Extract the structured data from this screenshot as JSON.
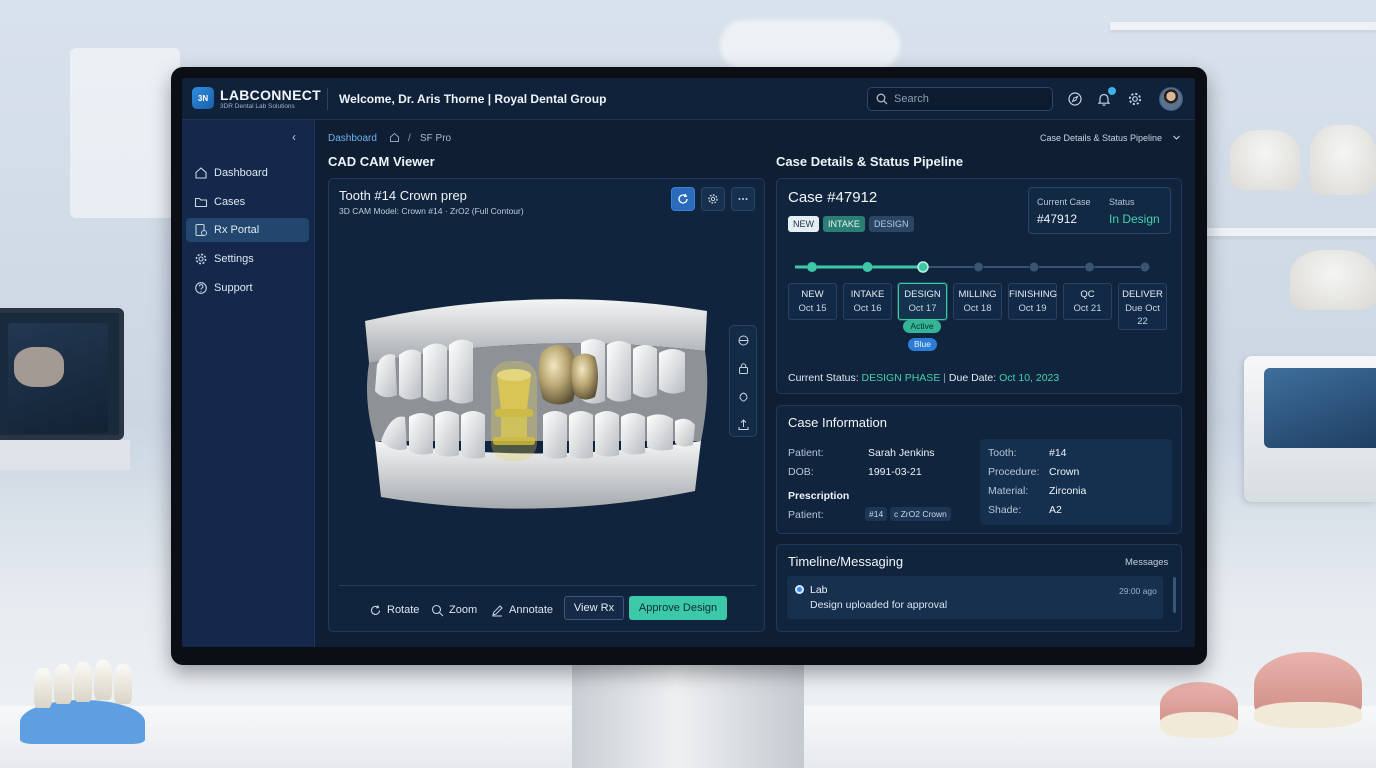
{
  "app": {
    "logo_mark": "3N",
    "name": "LABCONNECT",
    "tagline": "3DR Dental Lab Solutions",
    "welcome": "Welcome, Dr. Aris Thorne | Royal Dental Group"
  },
  "search": {
    "placeholder": "Search"
  },
  "icons": {
    "help": "compass-icon",
    "notifications": "bell-icon",
    "settings": "gear-icon"
  },
  "sidebar": {
    "collapse_glyph": "‹",
    "items": [
      {
        "label": "Dashboard",
        "icon": "home-icon",
        "active": false
      },
      {
        "label": "Cases",
        "icon": "folder-icon",
        "active": false
      },
      {
        "label": "Rx Portal",
        "icon": "rx-icon",
        "active": true
      },
      {
        "label": "Settings",
        "icon": "gear-icon",
        "active": false
      },
      {
        "label": "Support",
        "icon": "help-icon",
        "active": false
      }
    ]
  },
  "breadcrumb": {
    "link": "Dashboard",
    "separator": "/",
    "current": "SF Pro",
    "right_label": "Case Details & Status Pipeline"
  },
  "viewer": {
    "section_title": "CAD CAM Viewer",
    "title": "Tooth #14 Crown prep",
    "subtitle": "3D CAM Model: Crown #14 · ZrO2 (Full Contour)",
    "tools": [
      {
        "label": "Rotate",
        "icon": "rotate-icon"
      },
      {
        "label": "Zoom",
        "icon": "zoom-icon"
      },
      {
        "label": "Annotate",
        "icon": "pencil-icon"
      }
    ],
    "view_rx_label": "View Rx",
    "approve_label": "Approve Design"
  },
  "case": {
    "section_title": "Case Details & Status Pipeline",
    "title": "Case #47912",
    "tags": [
      "NEW",
      "INTAKE",
      "DESIGN"
    ],
    "current_case_label": "Current Case",
    "current_case_value": "#47912",
    "status_label": "Status",
    "status_value": "In Design",
    "stages": [
      {
        "name": "NEW",
        "date": "Oct 15"
      },
      {
        "name": "INTAKE",
        "date": "Oct 16"
      },
      {
        "name": "DESIGN",
        "date": "Oct 17"
      },
      {
        "name": "MILLING",
        "date": "Oct 18"
      },
      {
        "name": "FINISHING",
        "date": "Oct 19"
      },
      {
        "name": "QC",
        "date": "Oct 21"
      },
      {
        "name": "DELIVER",
        "date": "Due Oct 22"
      }
    ],
    "completed_stages": 3,
    "badge_active": "Active",
    "badge_blue": "Blue",
    "current_status_label": "Current Status:",
    "current_status_value": "DESIGN PHASE",
    "divider": "|",
    "due_label": "Due Date:",
    "due_value": "Oct 10, 2023",
    "colors": {
      "accent": "#3cc9a8",
      "pending": "#3a5473"
    }
  },
  "info": {
    "title": "Case Information",
    "patient_label": "Patient:",
    "patient_value": "Sarah Jenkins",
    "dob_label": "DOB:",
    "dob_value": "1991-03-21",
    "prescription_label": "Prescription",
    "rx_patient_label": "Patient:",
    "rx_pill_1": "#14",
    "rx_pill_2": "c ZrO2 Crown",
    "tooth_label": "Tooth:",
    "tooth_value": "#14",
    "procedure_label": "Procedure:",
    "procedure_value": "Crown",
    "material_label": "Material:",
    "material_value": "Zirconia",
    "shade_label": "Shade:",
    "shade_value": "A2"
  },
  "timeline": {
    "title": "Timeline/Messaging",
    "link": "Messages",
    "items": [
      {
        "from": "Lab",
        "message": "Design uploaded for approval",
        "time": "29:00 ago"
      }
    ]
  }
}
